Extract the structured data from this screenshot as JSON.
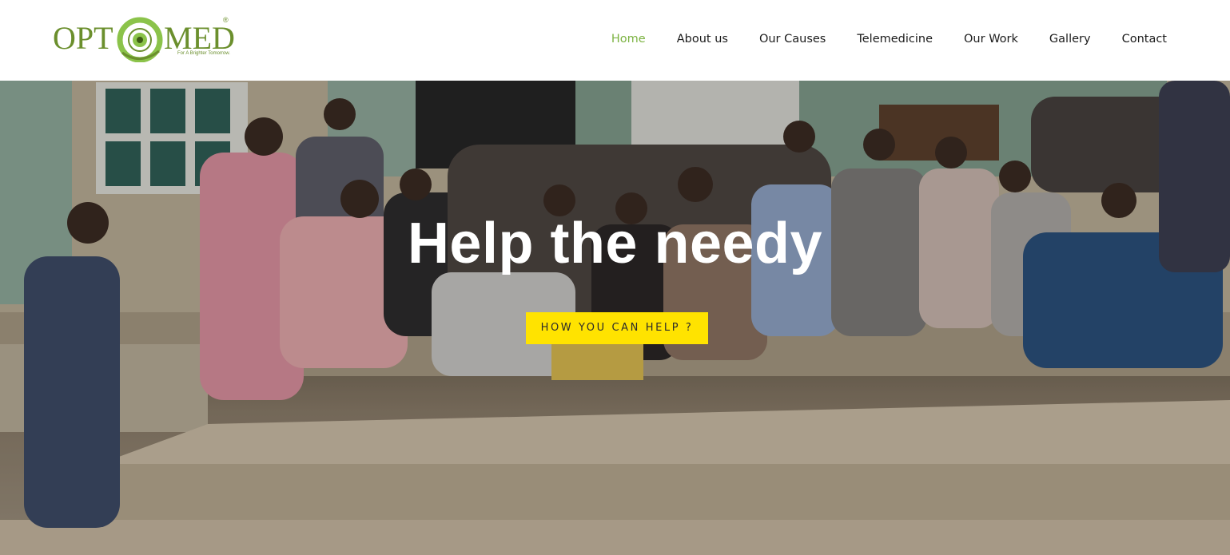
{
  "brand": {
    "name_left": "OPT",
    "name_right": "MED",
    "tagline": "For A Brighter Tomorrow.",
    "registered_mark": "®",
    "color": "#6b8f2d"
  },
  "nav": {
    "items": [
      {
        "label": "Home",
        "active": true
      },
      {
        "label": "About us",
        "active": false
      },
      {
        "label": "Our Causes",
        "active": false
      },
      {
        "label": "Telemedicine",
        "active": false
      },
      {
        "label": "Our Work",
        "active": false
      },
      {
        "label": "Gallery",
        "active": false
      },
      {
        "label": "Contact",
        "active": false
      }
    ],
    "active_color": "#7cb342"
  },
  "hero": {
    "title": "Help the needy",
    "cta_label": "HOW YOU CAN HELP ?",
    "cta_color": "#ffe300",
    "image_icon": "group-photo-image"
  }
}
